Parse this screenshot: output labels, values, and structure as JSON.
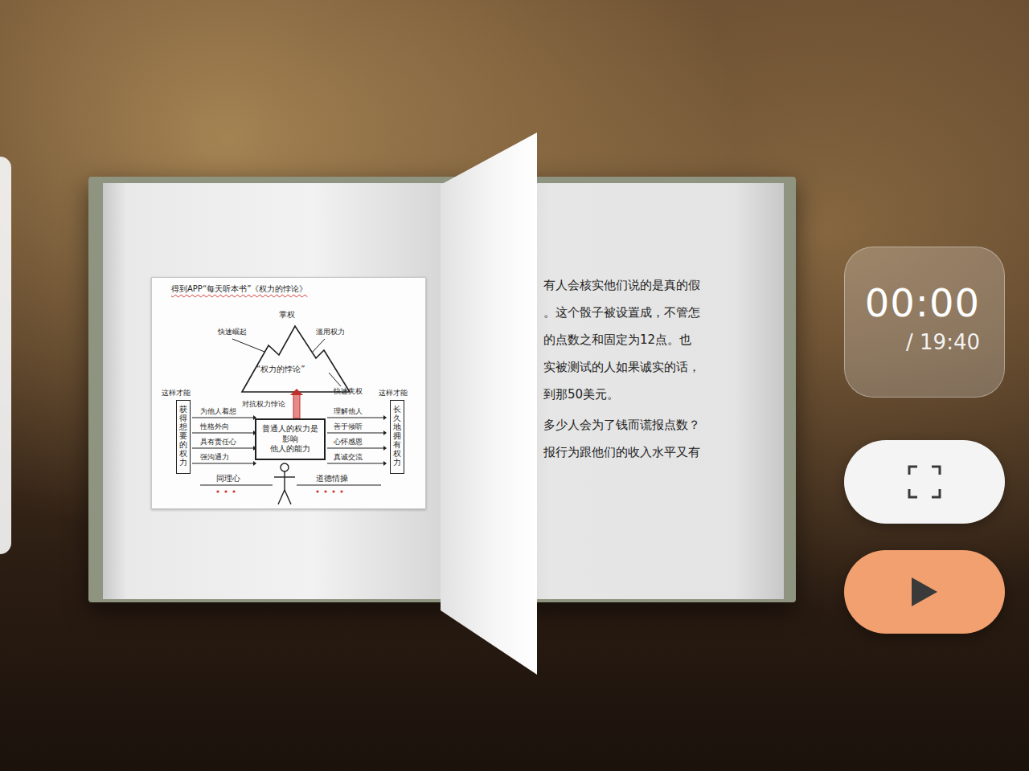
{
  "book": {
    "figure": {
      "title": "得到APP“每天听本书”《权力的悖论》",
      "peak": "掌权",
      "rise": "快速崛起",
      "abuse": "滥用权力",
      "mountain_label": "“权力的悖论”",
      "fall": "快速失权",
      "counter": "对抗权力悖论",
      "core": [
        "普通人的权力是",
        "影响",
        "他人的能力"
      ],
      "left_heading": "这样才能",
      "left_box": "获得想要的权力",
      "left_traits": [
        "为他人着想",
        "性格外向",
        "具有责任心",
        "强沟通力"
      ],
      "right_heading": "这样才能",
      "right_box": "长久地拥有权力",
      "right_traits": [
        "理解他人",
        "善于倾听",
        "心怀感恩",
        "真诚交流"
      ],
      "bottom": [
        "同理心",
        "道德情操"
      ]
    },
    "paragraphs": [
      [
        "有人会核实他们说的是真的假",
        "。这个骰子被设置成，不管怎",
        "的点数之和固定为12点。也",
        "实被测试的人如果诚实的话，",
        "到那50美元。"
      ],
      [
        "多少人会为了钱而谎报点数？",
        "报行为跟他们的收入水平又有"
      ]
    ]
  },
  "player": {
    "elapsed": "00:00",
    "total": "/ 19:40",
    "playing": false
  }
}
